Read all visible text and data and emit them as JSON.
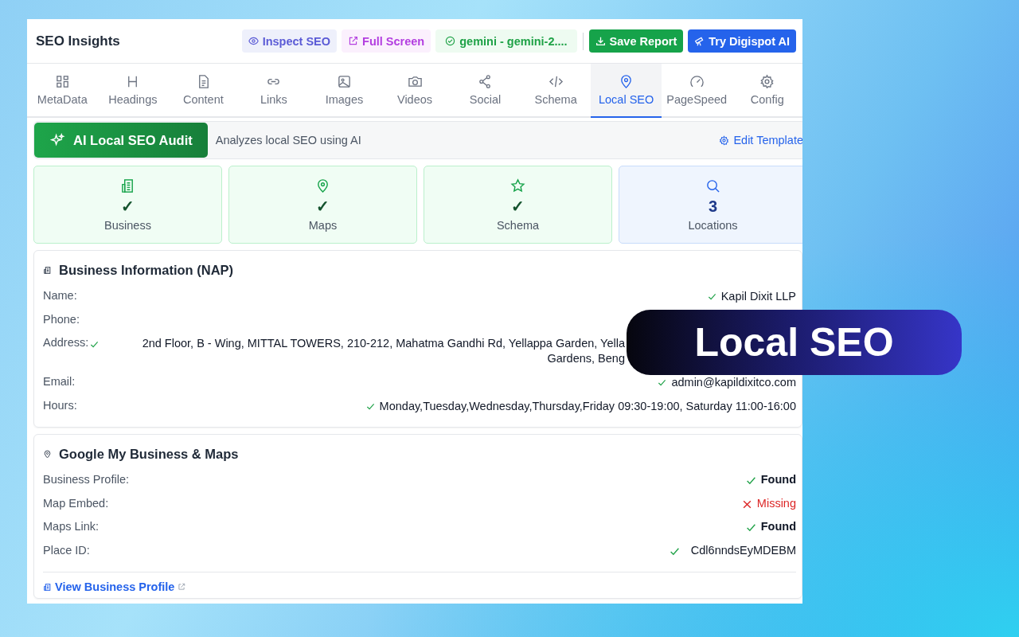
{
  "header": {
    "title": "SEO Insights",
    "buttons": [
      {
        "label": "Inspect SEO",
        "kind": "soft-indigo"
      },
      {
        "label": "Full Screen",
        "kind": "soft-purple"
      },
      {
        "label": "gemini - gemini-2....",
        "kind": "soft-green"
      },
      {
        "label": "Save Report",
        "kind": "solid-green"
      },
      {
        "label": "Try Digispot AI",
        "kind": "solid-blue"
      }
    ]
  },
  "tabs": [
    {
      "label": "MetaData",
      "selected": false
    },
    {
      "label": "Headings",
      "selected": false
    },
    {
      "label": "Content",
      "selected": false
    },
    {
      "label": "Links",
      "selected": false
    },
    {
      "label": "Images",
      "selected": false
    },
    {
      "label": "Videos",
      "selected": false
    },
    {
      "label": "Social",
      "selected": false
    },
    {
      "label": "Schema",
      "selected": false
    },
    {
      "label": "Local SEO",
      "selected": true
    },
    {
      "label": "PageSpeed",
      "selected": false
    },
    {
      "label": "Config",
      "selected": false
    }
  ],
  "audit": {
    "button": "AI Local SEO Audit",
    "description": "Analyzes local SEO using AI",
    "edit_link": "Edit Template"
  },
  "stats": [
    {
      "kind": "check",
      "value": "✓",
      "label": "Business"
    },
    {
      "kind": "check",
      "value": "✓",
      "label": "Maps"
    },
    {
      "kind": "check",
      "value": "✓",
      "label": "Schema"
    },
    {
      "kind": "count",
      "value": "3",
      "label": "Locations"
    }
  ],
  "business_info": {
    "title": "Business Information (NAP)",
    "rows": [
      {
        "label": "Name:",
        "value": [
          "Kapil Dixit LLP"
        ],
        "ok": true
      },
      {
        "label": "Phone:",
        "value": []
      },
      {
        "label": "Address:",
        "label_check": true,
        "value": [
          "2nd Floor, B - Wing, MITTAL TOWERS, 210-212, Mahatma Gandhi Rd, Yellappa Garden, Yella",
          "Gardens, Beng"
        ]
      },
      {
        "label": "Email:",
        "value": [
          "admin@kapildixitco.com"
        ],
        "ok": true
      },
      {
        "label": "Hours:",
        "value": [
          "Monday,Tuesday,Wednesday,Thursday,Friday 09:30-19:00, Saturday 11:00-16:00"
        ],
        "ok": true
      }
    ]
  },
  "maps": {
    "title": "Google My Business & Maps",
    "rows": [
      {
        "label": "Business Profile:",
        "value": "Found",
        "ok": true
      },
      {
        "label": "Map Embed:",
        "value": "Missing",
        "ok": false
      },
      {
        "label": "Maps Link:",
        "value": "Found",
        "ok": true
      },
      {
        "label": "Place ID:",
        "value": "Cdl6nndsEyMDEBM",
        "ok": true,
        "plain": true
      }
    ],
    "link": "View Business Profile"
  },
  "banner": {
    "text": "Local SEO"
  }
}
